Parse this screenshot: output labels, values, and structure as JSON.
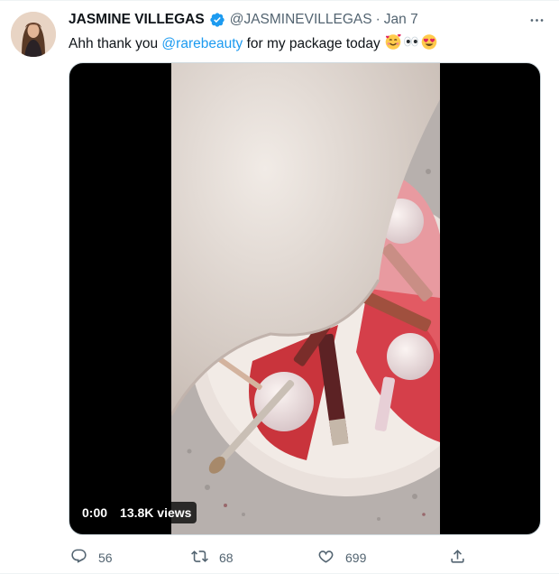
{
  "tweet": {
    "display_name": "JASMINE VILLEGAS",
    "handle": "@JASMINEVILLEGAS",
    "separator": "·",
    "date": "Jan 7",
    "text_before": "Ahh thank you ",
    "mention": "@rarebeauty",
    "text_after": " for my package today ",
    "emojis": [
      "smiling-face-with-hearts",
      "eyes",
      "heart-eyes"
    ]
  },
  "media": {
    "time": "0:00",
    "views": "13.8K views"
  },
  "actions": {
    "reply_count": "56",
    "retweet_count": "68",
    "like_count": "699"
  },
  "colors": {
    "accent": "#1d9bf0",
    "muted": "#536471",
    "text": "#0f1419"
  }
}
